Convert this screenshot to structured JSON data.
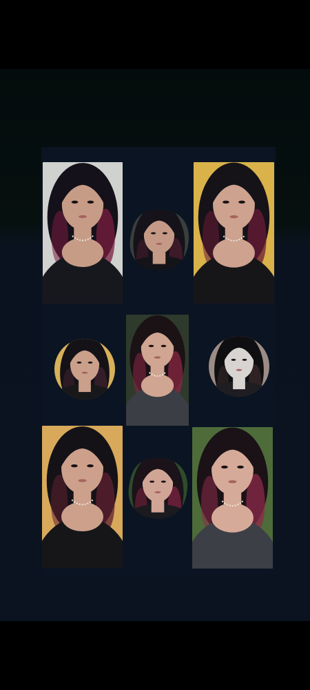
{
  "collage": {
    "tiles": [
      {
        "id": "t1",
        "shape": "rect",
        "bg": "#cfd2cf",
        "hair": "#14111a",
        "highlight": "#7a1d3f",
        "skin": "#c79c86",
        "top": "#17181d"
      },
      {
        "id": "t2",
        "shape": "blob",
        "bg": "#3a3f3d",
        "hair": "#15121a",
        "highlight": "#4b1d2e",
        "skin": "#c49a86",
        "top": "#141418"
      },
      {
        "id": "t3",
        "shape": "rect",
        "bg": "#d9b24a",
        "hair": "#151218",
        "highlight": "#6a1c36",
        "skin": "#cda28e",
        "top": "#161619"
      },
      {
        "id": "t4",
        "shape": "circle",
        "bg": "#d7b15a",
        "hair": "#141217",
        "highlight": "#3f2230",
        "skin": "#caa08b",
        "top": "#18181b"
      },
      {
        "id": "t5",
        "shape": "rect",
        "bg": "#2e3a2c",
        "hair": "#1b1216",
        "highlight": "#8a2743",
        "skin": "#d0a591",
        "top": "#3b3e44"
      },
      {
        "id": "t6",
        "shape": "circle",
        "bg": "#9b8c86",
        "hair": "#0f0f12",
        "highlight": "#3b2a2a",
        "skin": "#d8d4d2",
        "top": "#1e1e22"
      },
      {
        "id": "t7",
        "shape": "rect",
        "bg": "#d8a95a",
        "hair": "#151217",
        "highlight": "#602031",
        "skin": "#cda08b",
        "top": "#161619"
      },
      {
        "id": "t8",
        "shape": "blob",
        "bg": "#2f4b2c",
        "hair": "#1b1319",
        "highlight": "#7d2340",
        "skin": "#d1a595",
        "top": "#1a1a1f"
      },
      {
        "id": "t9",
        "shape": "rect",
        "bg": "#4e6b3a",
        "hair": "#1a1217",
        "highlight": "#8e2a49",
        "skin": "#d6aa98",
        "top": "#3c3f45"
      }
    ]
  }
}
